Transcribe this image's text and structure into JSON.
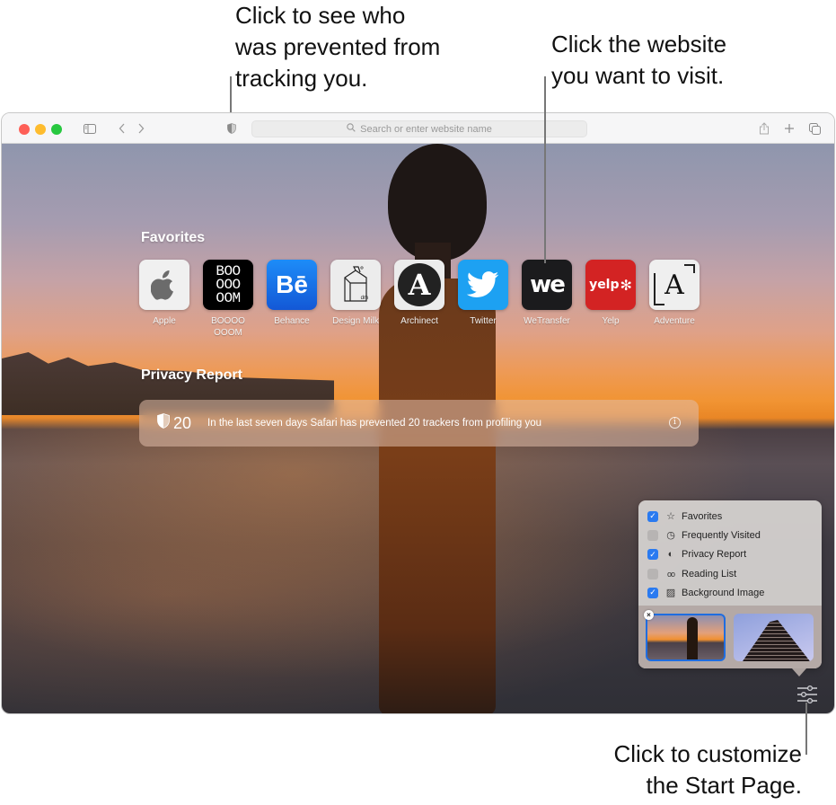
{
  "callouts": {
    "privacy": [
      "Click to see who",
      "was prevented from",
      "tracking you."
    ],
    "favorites": [
      "Click the website",
      "you want to visit."
    ],
    "customize": [
      "Click to customize",
      "the Start Page."
    ]
  },
  "toolbar": {
    "address_placeholder": "Search or enter website name",
    "icons": [
      "sidebar-icon",
      "back-icon",
      "forward-icon",
      "privacy-shield-icon",
      "share-icon",
      "new-tab-icon",
      "tab-overview-icon"
    ]
  },
  "favorites": {
    "title": "Favorites",
    "items": [
      {
        "label": "Apple",
        "bg": "#f0f0f0"
      },
      {
        "label": "BOOOO OOOM",
        "bg": "#000000"
      },
      {
        "label": "Behance",
        "bg": "#1769ff"
      },
      {
        "label": "Design Milk",
        "bg": "#ececec"
      },
      {
        "label": "Archinect",
        "bg": "#ececec"
      },
      {
        "label": "Twitter",
        "bg": "#1da1f2"
      },
      {
        "label": "WeTransfer",
        "bg": "#1b1b1d"
      },
      {
        "label": "Yelp",
        "bg": "#d32323"
      },
      {
        "label": "Adventure",
        "bg": "#efefef"
      }
    ],
    "tile_text": {
      "boooom": [
        "BOO",
        "OOO",
        "OOM"
      ],
      "behance": "Bē",
      "designmilk": "dm",
      "archinect": "A",
      "wetransfer": "we",
      "yelp": "yelp",
      "adventure": "A"
    }
  },
  "privacy_report": {
    "title": "Privacy Report",
    "count": "20",
    "message": "In the last seven days Safari has prevented 20 trackers from profiling you",
    "info": "i"
  },
  "customize_panel": {
    "items": [
      {
        "label": "Favorites",
        "checked": true,
        "icon": "☆"
      },
      {
        "label": "Frequently Visited",
        "checked": false,
        "icon": "◷"
      },
      {
        "label": "Privacy Report",
        "checked": true,
        "icon": "◐"
      },
      {
        "label": "Reading List",
        "checked": false,
        "icon": "oo"
      },
      {
        "label": "Background Image",
        "checked": true,
        "icon": "▨"
      }
    ],
    "check_glyph": "✓",
    "remove_glyph": "×",
    "accent": "#2a7af0"
  }
}
